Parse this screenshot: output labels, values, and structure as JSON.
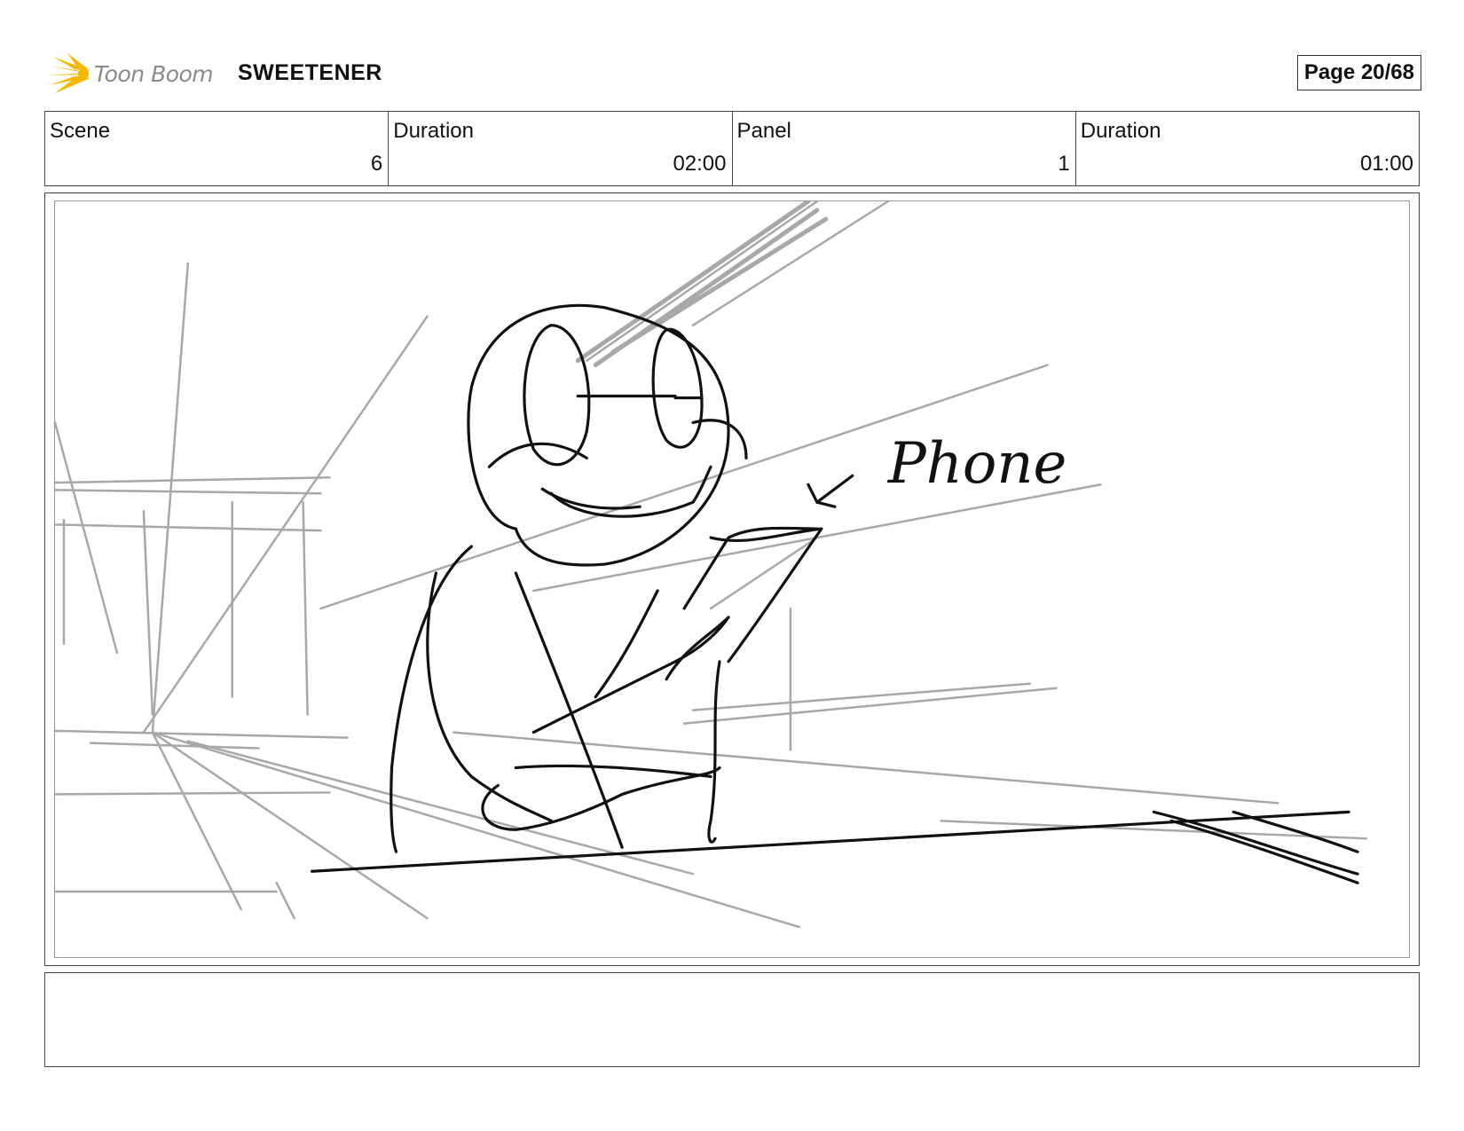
{
  "header": {
    "brand": "Toon Boom",
    "project": "SWEETENER",
    "page": "Page 20/68"
  },
  "info": [
    {
      "label": "Scene",
      "value": "6"
    },
    {
      "label": "Duration",
      "value": "02:00"
    },
    {
      "label": "Panel",
      "value": "1"
    },
    {
      "label": "Duration",
      "value": "01:00"
    }
  ],
  "panel": {
    "annotation": "Phone"
  },
  "notes": {
    "text": ""
  },
  "colors": {
    "logo_accent": "#f5b800",
    "sketch_dark": "#111111",
    "sketch_light": "#a8a8a8"
  }
}
